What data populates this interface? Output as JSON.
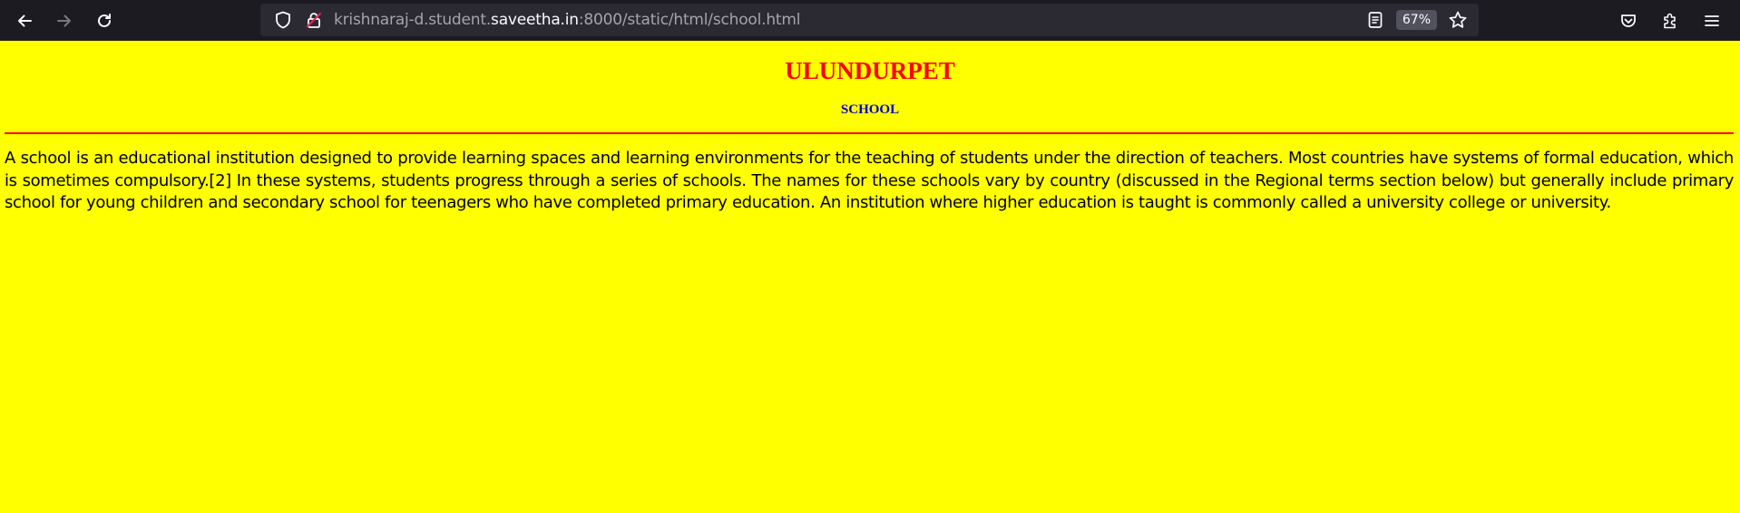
{
  "browser": {
    "url_prefix": "krishnaraj-d.student.",
    "url_host": "saveetha.in",
    "url_suffix": ":8000/static/html/school.html",
    "zoom": "67%",
    "icons": {
      "back": "back-arrow-icon",
      "forward": "forward-arrow-icon",
      "reload": "reload-icon",
      "tracking": "shield-icon",
      "permissions": "insecure-lock-icon",
      "reader": "reader-view-icon",
      "bookmark": "star-icon",
      "pocket": "pocket-icon",
      "extensions": "puzzle-icon",
      "menu": "hamburger-menu-icon"
    }
  },
  "page": {
    "background": "#ffff00",
    "title": "ULUNDURPET",
    "title_color": "#ff0000",
    "subtitle": "SCHOOL",
    "subtitle_color": "#0000cc",
    "divider_color": "#ff0000",
    "paragraph": "A school is an educational institution designed to provide learning spaces and learning environments for the teaching of students under the direction of teachers. Most countries have systems of formal education, which is sometimes compulsory.[2] In these systems, students progress through a series of schools. The names for these schools vary by country (discussed in the Regional terms section below) but generally include primary school for young children and secondary school for teenagers who have completed primary education. An institution where higher education is taught is commonly called a university college or university."
  }
}
